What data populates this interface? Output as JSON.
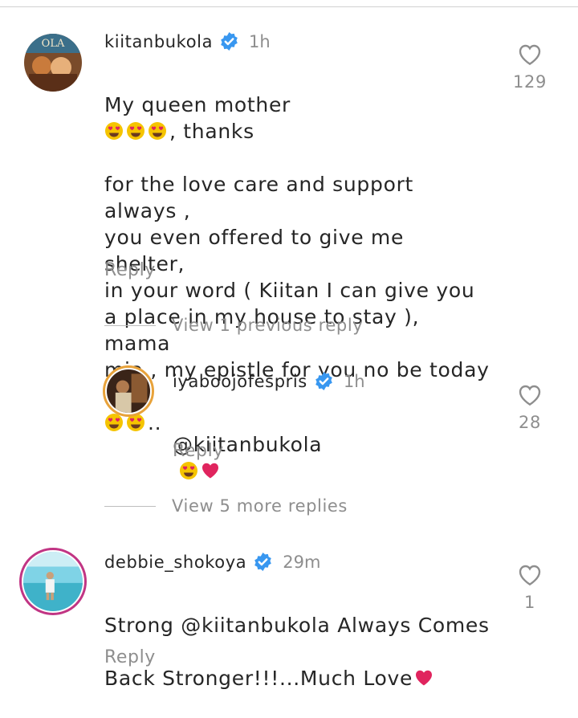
{
  "comments": [
    {
      "username": "kiitanbukola",
      "time": "1h",
      "text_line1": "My queen mother",
      "text_line1_after": ", thanks",
      "text_middle": "for the love care and support always ,\nyou even offered to give me shelter,\nin your word ( Kiitan I can give you\na place in my house to stay ), mama\nmia , my epistle for you no be today",
      "text_tail": "..",
      "reply_label": "Reply",
      "likes": "129"
    },
    {
      "username": "iyaboojofespris",
      "time": "1h",
      "mention": "@kiitanbukola",
      "reply_label": "Reply",
      "likes": "28"
    },
    {
      "username": "debbie_shokoya",
      "time": "29m",
      "text_before": "Strong ",
      "mention": "@kiitanbukola",
      "text_after": " Always Comes",
      "text_line2": "Back Stronger!!!...Much Love",
      "reply_label": "Reply",
      "likes": "1"
    }
  ],
  "view_previous": "View 1 previous reply",
  "view_more": "View 5 more replies",
  "avatar_labels": {
    "first": "OLA"
  },
  "icons": {
    "verified": "verified-badge-icon",
    "like": "heart-outline-icon",
    "emoji_love": "heart-eyes-emoji",
    "heart": "red-heart-emoji"
  },
  "colors": {
    "verified": "#3897f0",
    "muted": "#8e8e8e",
    "text": "#262626",
    "heart": "#e0245e",
    "emoji_face": "#f5c400"
  }
}
